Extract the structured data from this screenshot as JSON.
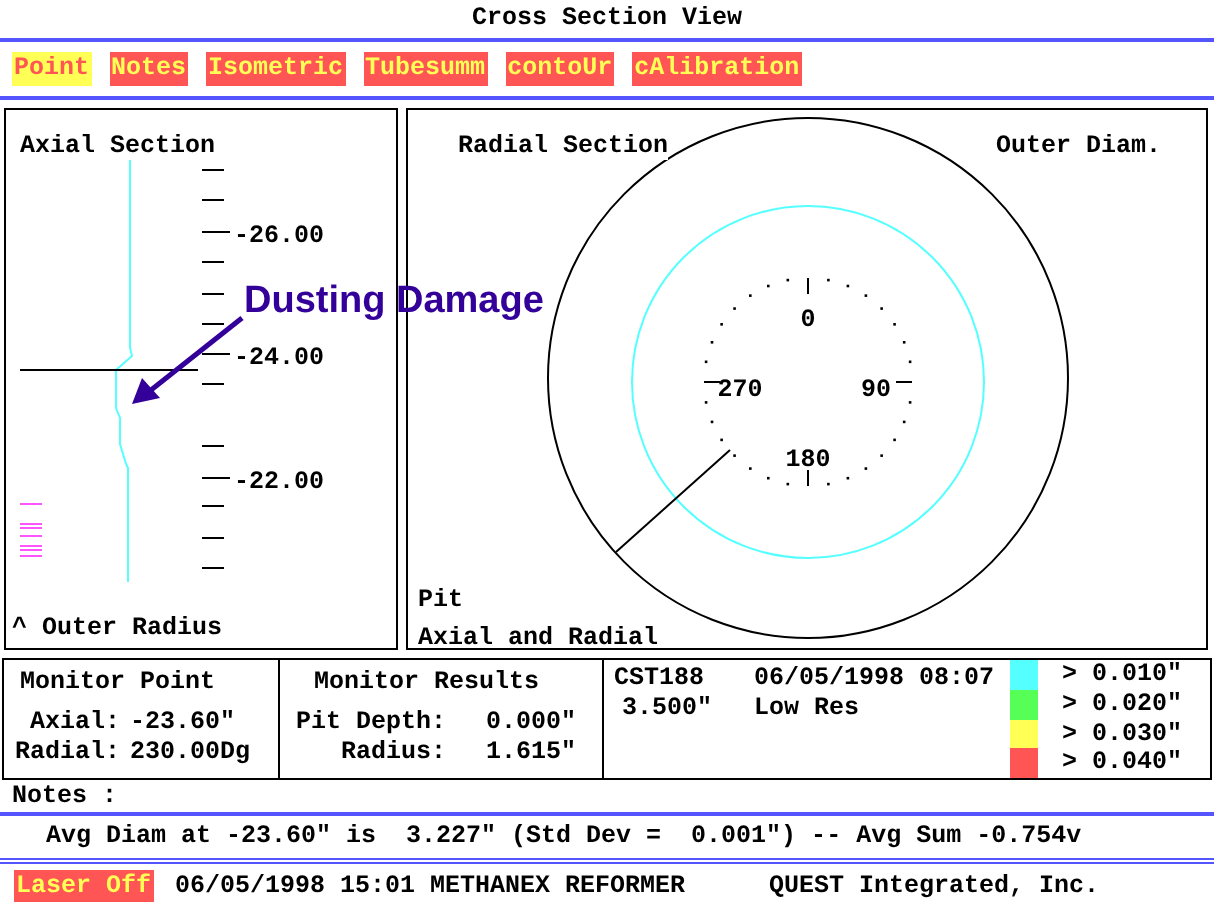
{
  "window": {
    "title": "Cross Section View"
  },
  "menu": [
    {
      "label": "Point",
      "selected": true
    },
    {
      "label": "Notes",
      "selected": false
    },
    {
      "label": "Isometric",
      "selected": false
    },
    {
      "label": "Tubesumm",
      "selected": false
    },
    {
      "label": "contoUr",
      "selected": false
    },
    {
      "label": "cAlibration",
      "selected": false
    }
  ],
  "axial_section": {
    "title": "Axial Section",
    "scale_labels": [
      "-26.00",
      "-24.00",
      "-22.00"
    ],
    "footer": "^ Outer Radius"
  },
  "annotation": {
    "text": "Dusting Damage"
  },
  "radial_section": {
    "title": "Radial Section",
    "mode": "Outer Diam.",
    "angle_labels": [
      "0",
      "90",
      "180",
      "270"
    ],
    "defect": "Pit",
    "view": "Axial and Radial"
  },
  "monitor_point": {
    "title": "Monitor Point",
    "axial_label": "Axial:",
    "axial": "-23.60\"",
    "radial_label": "Radial:",
    "radial": "230.00Dg"
  },
  "monitor_results": {
    "title": "Monitor Results",
    "pit_depth_label": "Pit Depth:",
    "pit_depth": "0.000\"",
    "radius_label": "Radius:",
    "radius": "1.615\""
  },
  "tube": {
    "id": "CST188",
    "datetime": "06/05/1998 08:07",
    "size": "3.500\"",
    "resolution": "Low Res"
  },
  "legend": [
    {
      "label": "> 0.010\"",
      "color": "#55ffff"
    },
    {
      "label": "> 0.020\"",
      "color": "#55ff55"
    },
    {
      "label": "> 0.030\"",
      "color": "#ffff55"
    },
    {
      "label": "> 0.040\"",
      "color": "#ff5555"
    }
  ],
  "notes": {
    "label": "Notes :",
    "text": "Avg Diam at -23.60\" is  3.227\" (Std Dev =  0.001\") -- Avg Sum -0.754v"
  },
  "status_bar": {
    "laser": {
      "label": "Laser Off",
      "on": false
    },
    "info": "06/05/1998 15:01 METHANEX REFORMER",
    "company": "QUEST Integrated, Inc."
  }
}
